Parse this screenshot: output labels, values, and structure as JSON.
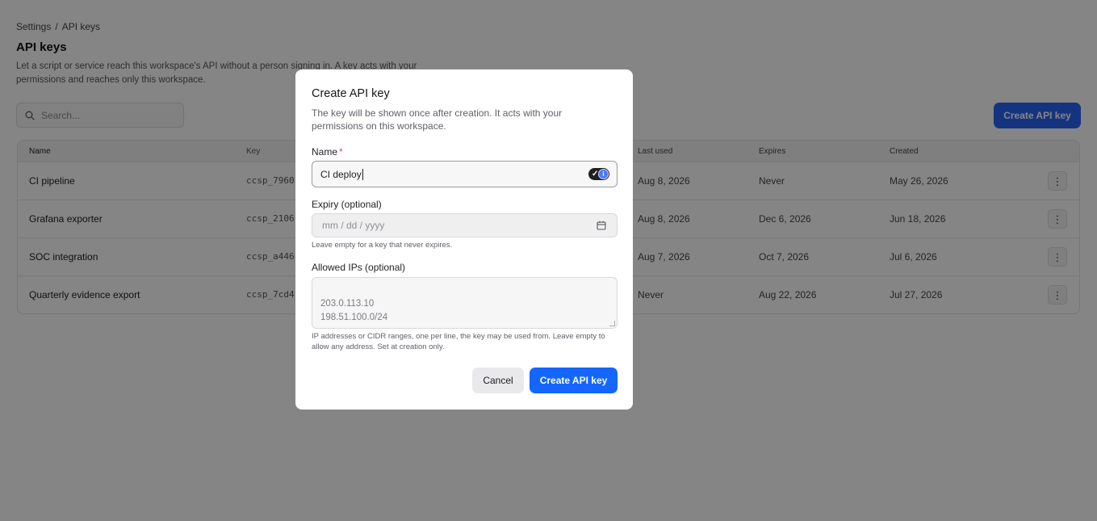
{
  "breadcrumb": [
    "Settings",
    "/",
    "API keys"
  ],
  "page": {
    "title": "API keys",
    "description": "Let a script or service reach this workspace's API without a person signing in. A key acts with your permissions and reaches only this workspace."
  },
  "search": {
    "placeholder": "Search...",
    "icon": "search-icon"
  },
  "toolbar": {
    "create_label": "Create API key"
  },
  "table": {
    "headers": {
      "name": "Name",
      "key": "Key",
      "last_used": "Last used",
      "expires": "Expires",
      "created": "Created"
    },
    "rows": [
      {
        "name": "CI pipeline",
        "key": "ccsp_7960",
        "last_used": "Aug 8, 2026",
        "expires": "Never",
        "created": "May 26, 2026"
      },
      {
        "name": "Grafana exporter",
        "key": "ccsp_2106",
        "last_used": "Aug 8, 2026",
        "expires": "Dec 6, 2026",
        "created": "Jun 18, 2026"
      },
      {
        "name": "SOC integration",
        "key": "ccsp_a446",
        "last_used": "Aug 7, 2026",
        "expires": "Oct 7, 2026",
        "created": "Jul 6, 2026"
      },
      {
        "name": "Quarterly evidence export",
        "key": "ccsp_7cd4",
        "last_used": "Never",
        "expires": "Aug 22, 2026",
        "created": "Jul 27, 2026"
      }
    ],
    "row_menu_glyph": "⋮"
  },
  "modal": {
    "title": "Create API key",
    "description": "The key will be shown once after creation. It acts with your permissions on this workspace.",
    "name_label": "Name",
    "required_mark": "*",
    "name_value": "CI deploy",
    "expiry_label": "Expiry (optional)",
    "expiry_placeholder": "mm / dd / yyyy",
    "expiry_hint": "Leave empty for a key that never expires.",
    "ips_label": "Allowed IPs (optional)",
    "ips_placeholder": "203.0.113.10\n198.51.100.0/24",
    "ips_hint": "IP addresses or CIDR ranges, one per line, the key may be used from. Leave empty to allow any address. Set at creation only.",
    "cancel_label": "Cancel",
    "create_label": "Create API key"
  },
  "colors": {
    "primary": "#1466ff",
    "required": "#e5484d",
    "overlay": "rgba(0,0,0,0.48)"
  }
}
